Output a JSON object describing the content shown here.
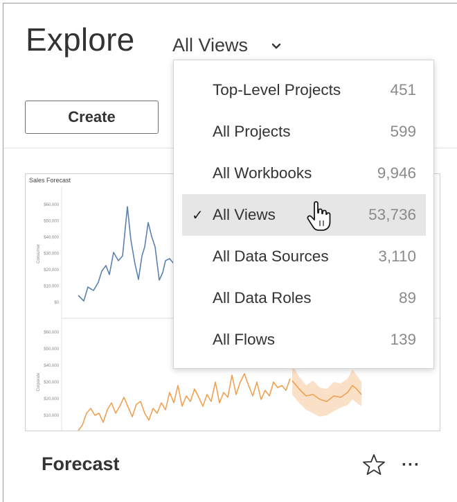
{
  "header": {
    "title": "Explore",
    "view_selector": "All Views"
  },
  "toolbar": {
    "create_label": "Create"
  },
  "dropdown": {
    "items": [
      {
        "label": "Top-Level Projects",
        "count": "451",
        "selected": false
      },
      {
        "label": "All Projects",
        "count": "599",
        "selected": false
      },
      {
        "label": "All Workbooks",
        "count": "9,946",
        "selected": false
      },
      {
        "label": "All Views",
        "count": "53,736",
        "selected": true
      },
      {
        "label": "All Data Sources",
        "count": "3,110",
        "selected": false
      },
      {
        "label": "All Data Roles",
        "count": "89",
        "selected": false
      },
      {
        "label": "All Flows",
        "count": "139",
        "selected": false
      }
    ],
    "check_mark": "✓"
  },
  "card": {
    "thumbnail_title": "Sales Forecast",
    "name": "Forecast",
    "more_label": "···",
    "favorite_icon": "star-outline-icon"
  },
  "thumbnail_chart": {
    "top_panel": {
      "axis_label": "Consumer",
      "ticks": [
        "$60,000",
        "$50,000",
        "$40,000",
        "$30,000",
        "$20,000",
        "$10,000",
        "$0"
      ],
      "color": "#5b80ad"
    },
    "bottom_panel": {
      "axis_label": "Corporate",
      "ticks": [
        "$60,000",
        "$50,000",
        "$40,000",
        "$30,000",
        "$20,000",
        "$10,000"
      ],
      "color": "#f0a050",
      "forecast_band_color": "#f9d3b0"
    }
  }
}
